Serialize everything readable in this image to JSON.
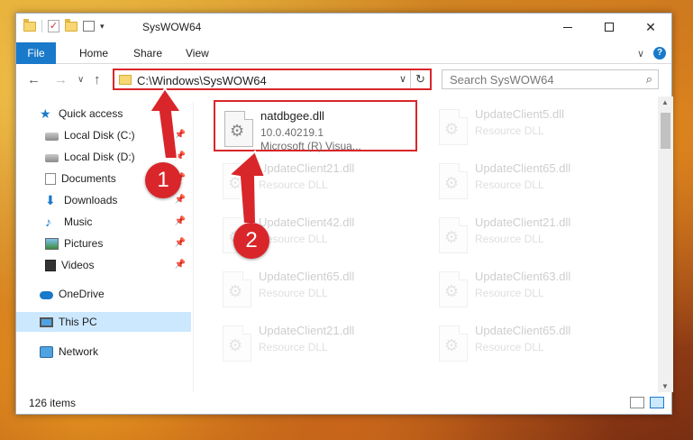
{
  "window": {
    "title": "SysWOW64",
    "minimize": "—",
    "maximize": "☐",
    "close": "✕"
  },
  "ribbon": {
    "tabs": [
      "File",
      "Home",
      "Share",
      "View"
    ],
    "expand": "∨",
    "help": "?"
  },
  "nav": {
    "back": "←",
    "forward": "→",
    "recent": "∨",
    "up": "↑",
    "address": "C:\\Windows\\SysWOW64",
    "address_dropdown": "∨",
    "refresh": "↻",
    "search_placeholder": "Search SysWOW64",
    "search_icon": "🔍"
  },
  "sidebar": {
    "items": [
      {
        "label": "Quick access",
        "icon": "star-icon",
        "pinned": false
      },
      {
        "label": "Local Disk (C:)",
        "icon": "disk-icon",
        "pinned": true
      },
      {
        "label": "Local Disk (D:)",
        "icon": "disk-icon",
        "pinned": true
      },
      {
        "label": "Documents",
        "icon": "documents-icon",
        "pinned": true
      },
      {
        "label": "Downloads",
        "icon": "download-icon",
        "pinned": true
      },
      {
        "label": "Music",
        "icon": "music-icon",
        "pinned": true
      },
      {
        "label": "Pictures",
        "icon": "pictures-icon",
        "pinned": true
      },
      {
        "label": "Videos",
        "icon": "videos-icon",
        "pinned": true
      },
      {
        "label": "OneDrive",
        "icon": "onedrive-icon",
        "pinned": false
      },
      {
        "label": "This PC",
        "icon": "pc-icon",
        "pinned": false,
        "selected": true
      },
      {
        "label": "Network",
        "icon": "network-icon",
        "pinned": false
      }
    ]
  },
  "files": [
    {
      "name": "natdbgee.dll",
      "line2": "10.0.40219.1",
      "line3": "Microsoft (R) Visua...",
      "highlight": true
    },
    {
      "name": "UpdateClient5.dll",
      "line2": "Resource DLL"
    },
    {
      "name": "UpdateClient21.dll",
      "line2": "Resource DLL"
    },
    {
      "name": "UpdateClient65.dll",
      "line2": "Resource DLL"
    },
    {
      "name": "UpdateClient42.dll",
      "line2": "Resource DLL"
    },
    {
      "name": "UpdateClient21.dll",
      "line2": "Resource DLL"
    },
    {
      "name": "UpdateClient65.dll",
      "line2": "Resource DLL"
    },
    {
      "name": "UpdateClient63.dll",
      "line2": "Resource DLL"
    },
    {
      "name": "UpdateClient21.dll",
      "line2": "Resource DLL"
    },
    {
      "name": "UpdateClient65.dll",
      "line2": "Resource DLL"
    }
  ],
  "status": {
    "item_count": "126 items"
  },
  "annotations": {
    "step1": "1",
    "step2": "2",
    "color": "#d9262a"
  }
}
